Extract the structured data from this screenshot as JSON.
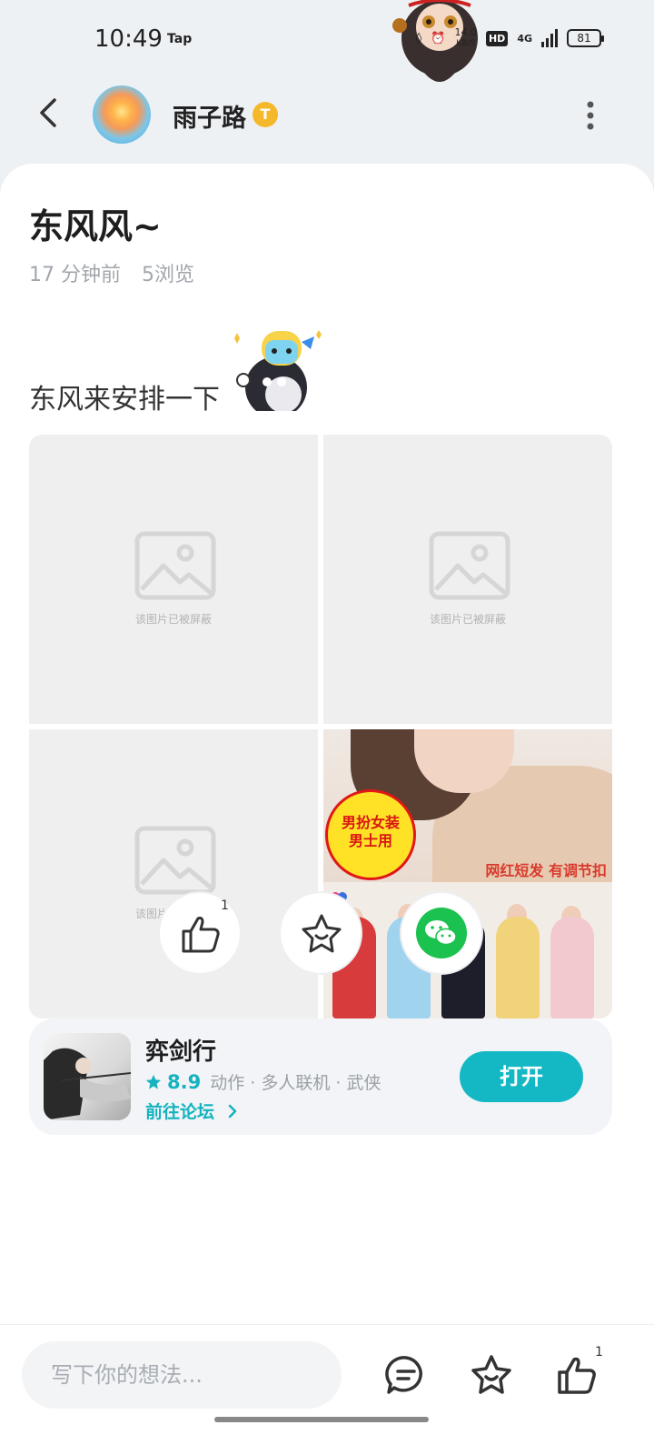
{
  "status_bar": {
    "time": "10:49",
    "app_tag": "Tap",
    "net_speed_value": "14.0",
    "net_speed_unit": "KB/S",
    "hd": "HD",
    "network": "4G",
    "battery": "81"
  },
  "header": {
    "username": "雨子路",
    "badge": "T"
  },
  "post": {
    "title": "东风风~",
    "time_ago": "17 分钟前",
    "views": "5浏览",
    "text": "东风来安排一下",
    "blocked_label": "该图片已被屏蔽",
    "ad_circle_line1": "男扮女装",
    "ad_circle_line2": "男士用",
    "ad_slogan": "网红短发 有调节扣"
  },
  "actions": {
    "like_count": "1"
  },
  "game": {
    "name": "弈剑行",
    "score": "8.9",
    "tags": "动作 · 多人联机 · 武侠",
    "forum_link": "前往论坛",
    "open_label": "打开"
  },
  "bottom_bar": {
    "input_placeholder": "写下你的想法...",
    "like_count": "1"
  },
  "colors": {
    "accent": "#14b8c4",
    "wechat": "#1bc24f",
    "badge": "#f5b82a"
  }
}
